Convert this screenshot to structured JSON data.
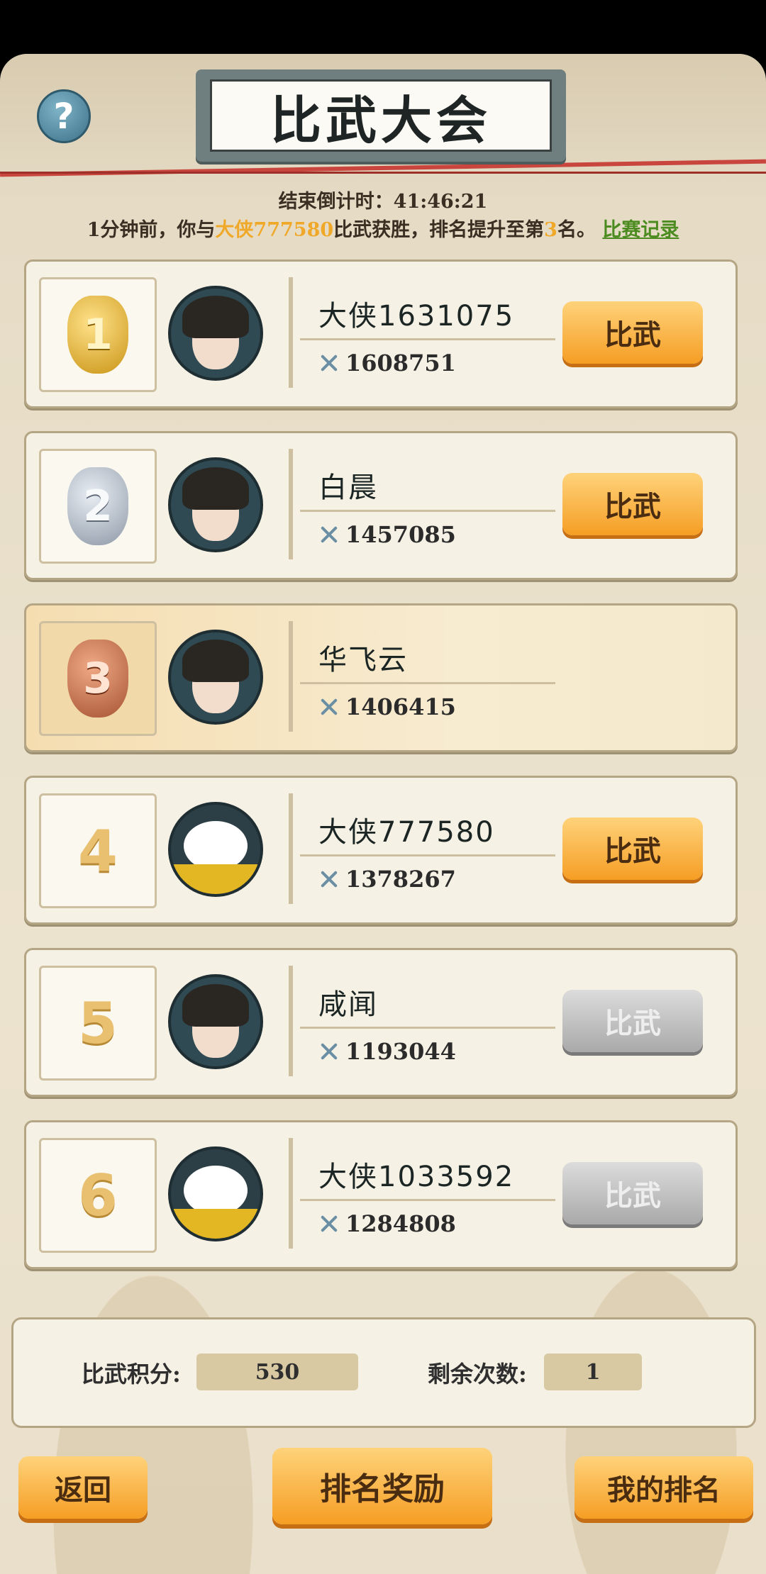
{
  "header": {
    "title": "比武大会",
    "help_icon": "?"
  },
  "status": {
    "countdown_label": "结束倒计时：",
    "countdown_value": "41:46:21",
    "msg_prefix": "1分钟前，你与",
    "msg_opponent": "大侠777580",
    "msg_mid": "比武获胜，排名提升至第",
    "msg_rank": "3",
    "msg_suffix": "名。",
    "record_link": "比赛记录"
  },
  "ranking": [
    {
      "rank": "1",
      "medal": "gold",
      "name": "大侠1631075",
      "power": "1608751",
      "button": "比武",
      "enabled": true,
      "highlight": false,
      "avatar": "swordsman-portrait"
    },
    {
      "rank": "2",
      "medal": "silver",
      "name": "白晨",
      "power": "1457085",
      "button": "比武",
      "enabled": true,
      "highlight": false,
      "avatar": "warrior-headband-portrait"
    },
    {
      "rank": "3",
      "medal": "bronze",
      "name": "华飞云",
      "power": "1406415",
      "button": "",
      "enabled": false,
      "highlight": true,
      "avatar": "longhair-swordsman-portrait"
    },
    {
      "rank": "4",
      "medal": "",
      "name": "大侠777580",
      "power": "1378267",
      "button": "比武",
      "enabled": true,
      "highlight": false,
      "avatar": "panda-portrait"
    },
    {
      "rank": "5",
      "medal": "",
      "name": "咸闻",
      "power": "1193044",
      "button": "比武",
      "enabled": false,
      "highlight": false,
      "avatar": "longhair-swordsman-portrait"
    },
    {
      "rank": "6",
      "medal": "",
      "name": "大侠1033592",
      "power": "1284808",
      "button": "比武",
      "enabled": false,
      "highlight": false,
      "avatar": "panda-portrait"
    }
  ],
  "stats": {
    "points_label": "比武积分:",
    "points_value": "530",
    "remaining_label": "剩余次数:",
    "remaining_value": "1"
  },
  "buttons": {
    "back": "返回",
    "rewards": "排名奖励",
    "my_rank": "我的排名"
  },
  "colors": {
    "accent_orange": "#f59e24",
    "highlight_name": "#f0a828",
    "record_green": "#4b8b1f"
  }
}
